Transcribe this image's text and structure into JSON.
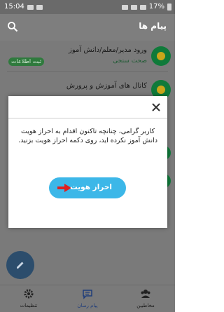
{
  "status_bar": {
    "time": "15:04",
    "battery": "17%"
  },
  "header": {
    "title": "پیام ها"
  },
  "list": [
    {
      "title": "ورود مدیر/معلم/دانش آموز",
      "subtitle": "صحت سنجی",
      "badge": "ثبت اطلاعات"
    },
    {
      "title": "کانال های آموزش و پرورش"
    }
  ],
  "bottom_nav": [
    {
      "label": "مخاطبین"
    },
    {
      "label": "پیام رسان"
    },
    {
      "label": "تنظیمات"
    }
  ],
  "dialog": {
    "message": "کاربر گرامی، چنانچه تاکنون اقدام به احراز هویت دانش آموز نکرده اید، روی دکمه احراز هویت بزنید.",
    "button_label": "احراز هویت"
  },
  "colors": {
    "button": "#3cb7e8",
    "arrow": "#e02020",
    "brand": "#0f7a3a"
  }
}
